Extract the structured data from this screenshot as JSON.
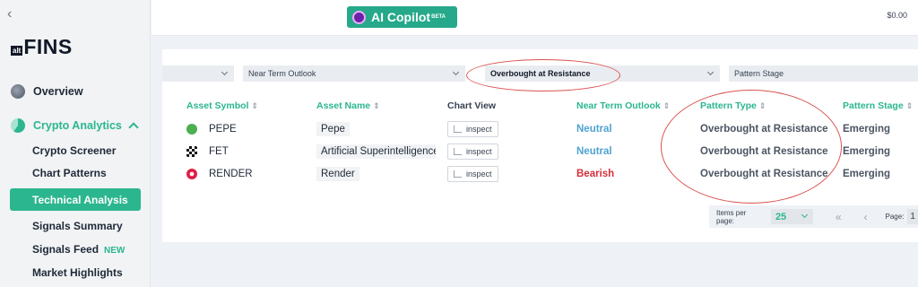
{
  "sidebar": {
    "logo_prefix": "alt",
    "logo_main": "FINS",
    "overview": "Overview",
    "crypto_analytics": "Crypto Analytics",
    "sub_items": {
      "screener": "Crypto Screener",
      "chart_patterns": "Chart Patterns",
      "technical_analysis": "Technical Analysis",
      "signals_summary": "Signals Summary",
      "signals_feed": "Signals Feed",
      "new_badge": "NEW",
      "market_highlights": "Market Highlights"
    }
  },
  "header": {
    "copilot_label": "AI Copilot",
    "copilot_badge": "BETA",
    "balance": "$0.00"
  },
  "filters": {
    "first": "",
    "near_term_outlook": "Near Term Outlook",
    "pattern_type": "Overbought at Resistance",
    "pattern_stage": "Pattern Stage"
  },
  "table": {
    "headers": {
      "asset_symbol": "Asset Symbol",
      "asset_name": "Asset Name",
      "chart_view": "Chart View",
      "near_term_outlook": "Near Term Outlook",
      "pattern_type": "Pattern Type",
      "pattern_stage": "Pattern Stage"
    },
    "rows": [
      {
        "symbol": "PEPE",
        "name": "Pepe",
        "chart": "inspect",
        "outlook": "Neutral",
        "outlook_color": "#4fa3d1",
        "pattern": "Overbought at Resistance",
        "stage": "Emerging"
      },
      {
        "symbol": "FET",
        "name": "Artificial Superintelligence",
        "chart": "inspect",
        "outlook": "Neutral",
        "outlook_color": "#4fa3d1",
        "pattern": "Overbought at Resistance",
        "stage": "Emerging"
      },
      {
        "symbol": "RENDER",
        "name": "Render",
        "chart": "inspect",
        "outlook": "Bearish",
        "outlook_color": "#d32f3a",
        "pattern": "Overbought at Resistance",
        "stage": "Emerging"
      }
    ]
  },
  "pagination": {
    "items_per_page_label": "Items per page:",
    "items_per_page": "25",
    "page_label": "Page:",
    "page_value": "1"
  },
  "colors": {
    "accent": "#2bb68f",
    "neutral": "#4fa3d1",
    "bearish": "#d32f3a",
    "annotation": "#d9534f"
  }
}
